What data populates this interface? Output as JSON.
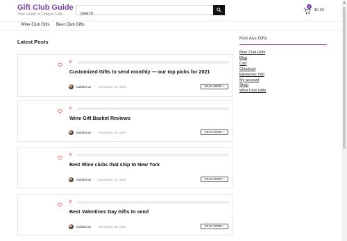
{
  "header": {
    "site_title": "Gift Club Guide",
    "tagline": "Your Guide to Unique Gifts",
    "search_placeholder": "Search",
    "cart_count": "0",
    "cart_total": "$0.00"
  },
  "nav": {
    "items": [
      {
        "label": "Wine Club Gifts"
      },
      {
        "label": "Beer Club Gifts"
      }
    ]
  },
  "main": {
    "section_title": "Latest Posts",
    "posts": [
      {
        "likes": "0",
        "title": "Customized Gifts to send monthly — our top picks for 2021",
        "author": "toddfarmer",
        "separator": "-",
        "date": "December 29, 2022",
        "read_more": "READ MORE »"
      },
      {
        "likes": "0",
        "title": "Wine Gift Basket Reviews",
        "author": "toddfarmer",
        "separator": "-",
        "date": "December 29, 2020",
        "read_more": "READ MORE »"
      },
      {
        "likes": "0",
        "title": "Best Wine clubs that ship to New York",
        "author": "toddfarmer",
        "separator": "-",
        "date": "December 29, 2020",
        "read_more": "READ MORE »"
      },
      {
        "likes": "0",
        "title": "Best Valentines Day Gifts to send",
        "author": "toddfarmer",
        "separator": "-",
        "date": "December 29, 2020",
        "read_more": "READ MORE »"
      }
    ]
  },
  "sidebar": {
    "widget_title": "Kick Ass Gifts",
    "links": [
      {
        "label": "Beer Club Gifts"
      },
      {
        "label": "Blog"
      },
      {
        "label": "Cart"
      },
      {
        "label": "Checkout"
      },
      {
        "label": "Elementor #90"
      },
      {
        "label": "My account"
      },
      {
        "label": "Shop"
      },
      {
        "label": "Wine Club Gifts"
      }
    ]
  },
  "colors": {
    "brand": "#7b3fa6",
    "like_red": "#e04848"
  },
  "icons": {
    "search": "search-icon",
    "cart": "cart-icon",
    "heart": "heart-icon"
  }
}
